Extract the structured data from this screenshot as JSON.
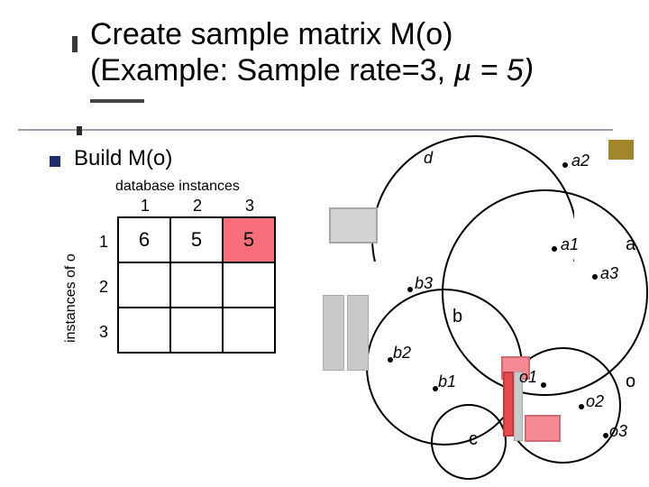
{
  "title": {
    "line1": "Create sample matrix M(o)",
    "line2_a": "(Example: Sample rate=3, ",
    "line2_b": "µ = 5)",
    "line2_full": "(Example: Sample rate=3, µ = 5)"
  },
  "bullet": {
    "label": "Build M(o)"
  },
  "table": {
    "caption": "database instances",
    "ylabel": "instances of o",
    "col_headers": [
      "1",
      "2",
      "3"
    ],
    "row_headers": [
      "1",
      "2",
      "3"
    ],
    "cells": {
      "r1c1": "6",
      "r1c2": "5",
      "r1c3": "5"
    }
  },
  "scene": {
    "d": "d",
    "a": "a",
    "b": "b",
    "c": "c",
    "o": "o",
    "a1": "a1",
    "a2": "a2",
    "a3": "a3",
    "b1": "b1",
    "b2": "b2",
    "b3": "b3",
    "o1": "o1",
    "o2": "o2",
    "o3": "o3"
  },
  "chart_data": {
    "type": "table",
    "title": "Sample matrix M(o)",
    "sample_rate": 3,
    "mu": 5,
    "columns": [
      "1",
      "2",
      "3"
    ],
    "rows": [
      "1",
      "2",
      "3"
    ],
    "values": [
      [
        6,
        5,
        5
      ],
      [
        null,
        null,
        null
      ],
      [
        null,
        null,
        null
      ]
    ],
    "highlight": [
      [
        0,
        2
      ]
    ]
  }
}
